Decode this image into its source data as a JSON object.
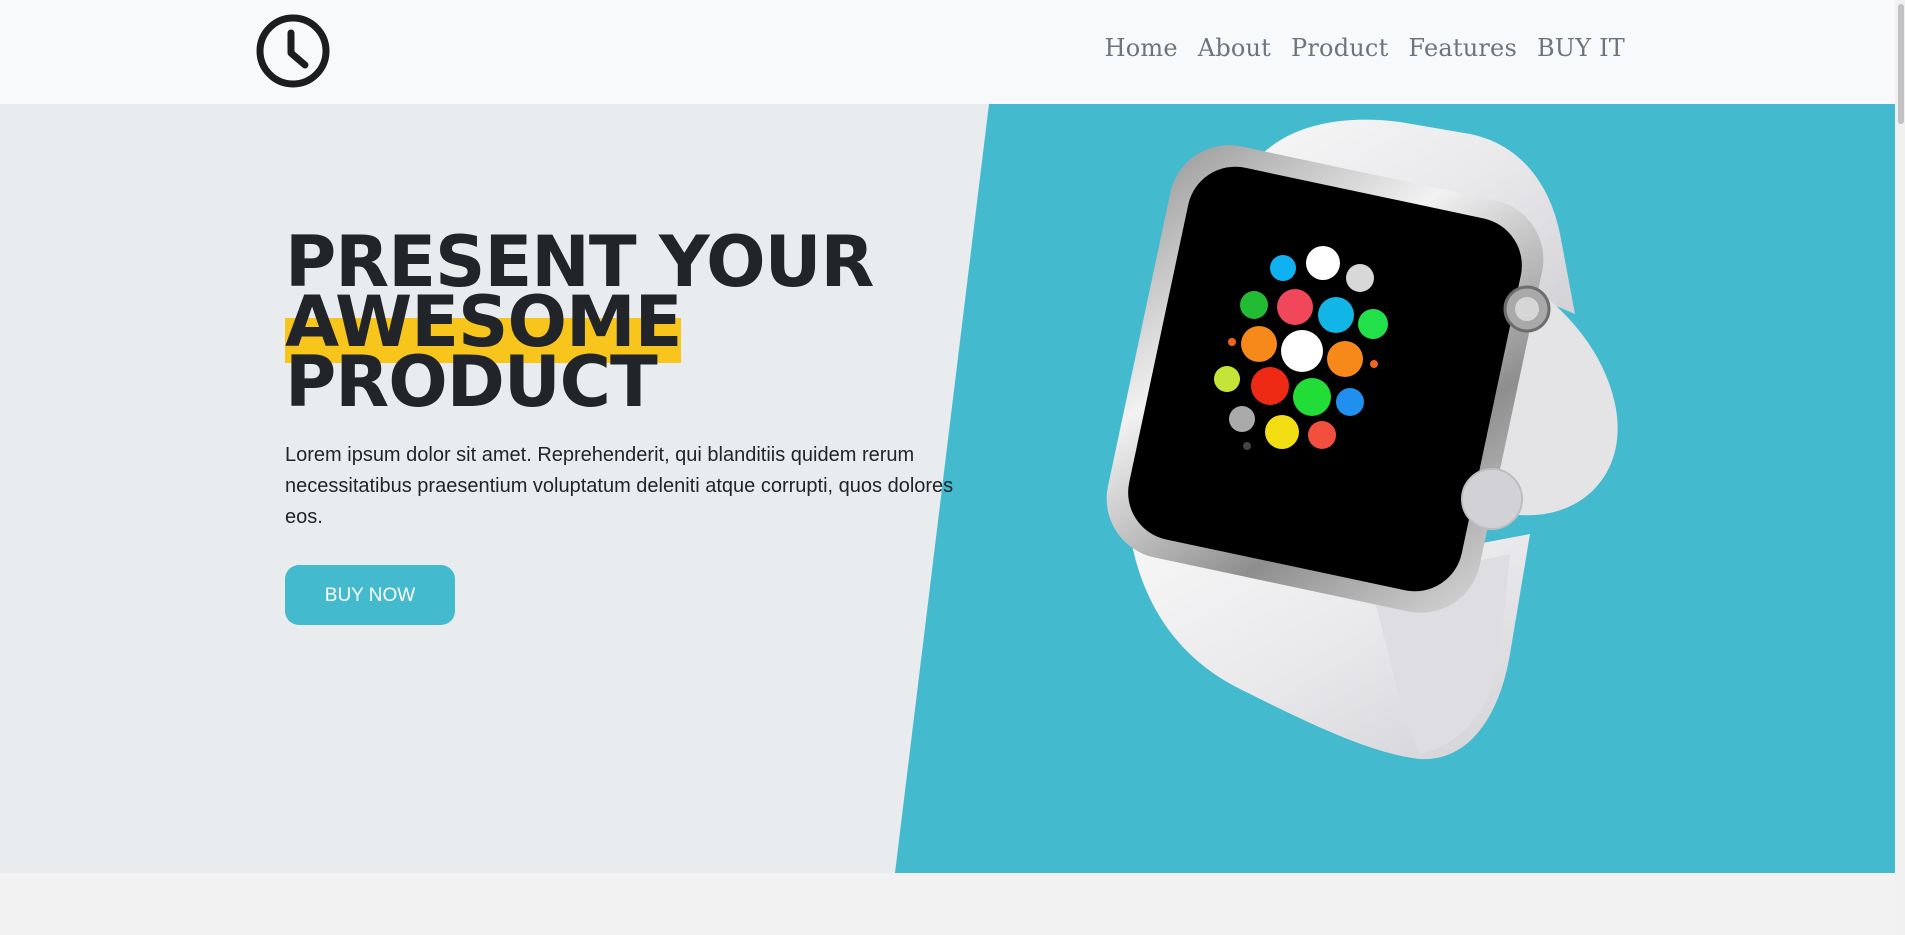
{
  "header": {
    "logo_icon": "clock-icon",
    "nav": [
      {
        "label": "Home"
      },
      {
        "label": "About"
      },
      {
        "label": "Product"
      },
      {
        "label": "Features"
      },
      {
        "label": "BUY IT"
      }
    ]
  },
  "hero": {
    "title_line1": "PRESENT YOUR",
    "title_line2": "AWESOME",
    "title_line3": "PRODUCT",
    "description": "Lorem ipsum dolor sit amet. Reprehenderit, qui blanditiis quidem rerum necessitatibus praesentium voluptatum deleniti atque corrupti, quos dolores eos.",
    "button_label": "BUY NOW",
    "image": "smartwatch-image"
  },
  "colors": {
    "accent": "#43bace",
    "highlight": "#f8c51c",
    "hero_bg": "#e9ecef",
    "text": "#212529"
  }
}
